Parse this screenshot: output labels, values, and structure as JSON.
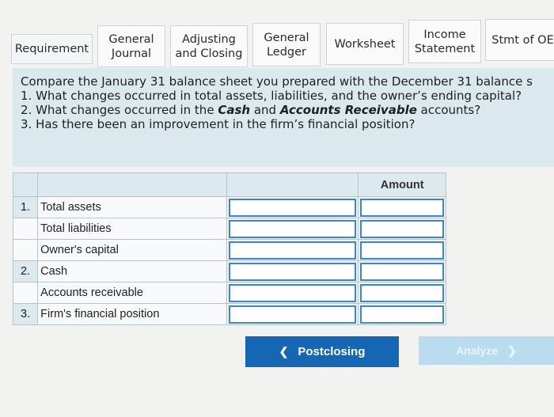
{
  "tabs": [
    {
      "lines": [
        "Requirement"
      ]
    },
    {
      "lines": [
        "General",
        "Journal"
      ]
    },
    {
      "lines": [
        "Adjusting",
        "and Closing"
      ]
    },
    {
      "lines": [
        "General",
        "Ledger"
      ]
    },
    {
      "lines": [
        "Worksheet"
      ]
    },
    {
      "lines": [
        "Income",
        "Statement"
      ]
    },
    {
      "lines": [
        "Stmt of OE"
      ]
    }
  ],
  "question": {
    "intro": "Compare the January 31 balance sheet you prepared with the December 31 balance s",
    "q1": "1. What changes occurred in total assets, liabilities, and the owner’s ending capital?",
    "q2_pre": "2. What changes occurred in the ",
    "q2_cash": "Cash",
    "q2_mid": " and ",
    "q2_ar": "Accounts Receivable",
    "q2_post": " accounts?",
    "q3": "3. Has there been an improvement in the firm’s financial position?"
  },
  "table": {
    "amount_header": "Amount",
    "rows": [
      {
        "num": "1.",
        "label": "Total assets"
      },
      {
        "num": "",
        "label": "Total liabilities"
      },
      {
        "num": "",
        "label": "Owner's capital"
      },
      {
        "num": "2.",
        "label": "Cash"
      },
      {
        "num": "",
        "label": "Accounts receivable"
      },
      {
        "num": "3.",
        "label": "Firm's financial position"
      }
    ]
  },
  "buttons": {
    "prev_label": "Postclosing",
    "next_label": "Analyze"
  },
  "colors": {
    "primary_button": "#1567b3",
    "disabled_button": "#b9dcef",
    "panel": "#dbe8ee",
    "input_border": "#3d87c8"
  },
  "icons": {
    "prev": "chevron-left-icon",
    "next": "chevron-right-icon"
  }
}
